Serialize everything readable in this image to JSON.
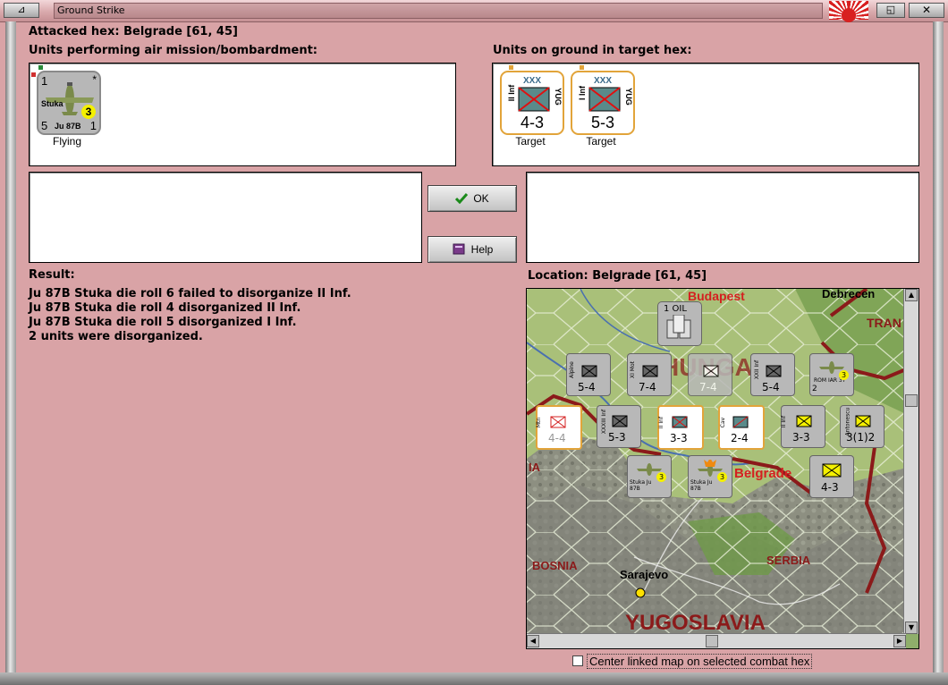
{
  "window": {
    "title": "Ground Strike",
    "minimize_glyph": "⊿",
    "restore_glyph": "◱",
    "close_glyph": "✕",
    "flag_icon": "rising-sun-flag-icon"
  },
  "header": {
    "attacked_hex": "Attacked hex: Belgrade  [61, 45]",
    "air_units_label": "Units performing air mission/bombardment:",
    "ground_units_label": "Units on ground in target hex:"
  },
  "air_units": [
    {
      "top_left": "1",
      "top_right": "*",
      "name": "Stuka",
      "badge": "3",
      "bottom_left": "5",
      "model": "Ju 87B",
      "bottom_right": "1",
      "status": "Flying"
    }
  ],
  "ground_units": [
    {
      "size": "XXX",
      "side_label": "II Inf",
      "nation": "YUG",
      "strength": "4-3",
      "status": "Target"
    },
    {
      "size": "XXX",
      "side_label": "I Inf",
      "nation": "YUG",
      "strength": "5-3",
      "status": "Target"
    }
  ],
  "buttons": {
    "ok": {
      "label": "OK",
      "icon": "checkmark-icon"
    },
    "help": {
      "label": "Help",
      "icon": "book-icon"
    }
  },
  "result": {
    "label": "Result:",
    "lines": [
      "Ju 87B Stuka die roll 6 failed to disorganize II Inf.",
      "Ju 87B Stuka die roll 4 disorganized II Inf.",
      "Ju 87B Stuka die roll 5 disorganized I Inf.",
      "2 units were disorganized."
    ]
  },
  "location": {
    "label": "Location:  Belgrade  [61, 45]"
  },
  "map": {
    "places": {
      "budapest": "Budapest",
      "debrecen": "Debrecen",
      "tran": "TRAN",
      "belgrade": "Belgrade",
      "bosnia": "BOSNIA",
      "serbia": "SERBIA",
      "sarajevo": "Sarajevo",
      "yugoslavia": "YUGOSLAVIA",
      "ia": "IA",
      "hunga": "HUNGA"
    },
    "oil": "1 OIL",
    "counters": [
      {
        "type": "Alpine",
        "strength": "5-4"
      },
      {
        "type": "XI Mot",
        "strength": "7-4"
      },
      {
        "type": "",
        "strength": "7-4"
      },
      {
        "type": "XXII Inf",
        "strength": "5-4"
      },
      {
        "type": "ROM IAR 37",
        "strength": "2"
      },
      {
        "type": "Mtn",
        "strength": "4-4"
      },
      {
        "type": "XXXIII Inf",
        "strength": "5-3"
      },
      {
        "type": "II Inf",
        "strength": "3-3"
      },
      {
        "type": "Cav",
        "strength": "2-4"
      },
      {
        "type": "II Inf",
        "strength": "3-3"
      },
      {
        "type": "Antonescu",
        "strength": "3(1)2"
      },
      {
        "type": "Stuka Ju 87B",
        "strength": "3"
      },
      {
        "type": "Stuka Ju 87B",
        "strength": "3"
      },
      {
        "type": "",
        "strength": "4-3"
      }
    ]
  },
  "footer": {
    "center_checkbox": "Center linked map on selected combat hex",
    "center_checked": false
  }
}
